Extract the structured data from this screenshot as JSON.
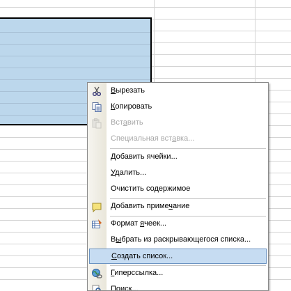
{
  "context_menu": {
    "items": [
      {
        "label_pre": "",
        "mnemonic": "В",
        "label_post": "ырезать",
        "icon": "scissors-icon",
        "enabled": true
      },
      {
        "label_pre": "",
        "mnemonic": "К",
        "label_post": "опировать",
        "icon": "copy-icon",
        "enabled": true
      },
      {
        "label_pre": "Вст",
        "mnemonic": "а",
        "label_post": "вить",
        "icon": "paste-icon",
        "enabled": false
      },
      {
        "label_pre": "Специальная вст",
        "mnemonic": "а",
        "label_post": "вка...",
        "icon": "",
        "enabled": false
      },
      {
        "label_pre": "",
        "mnemonic": "Д",
        "label_post": "обавить ячейки...",
        "icon": "",
        "enabled": true
      },
      {
        "label_pre": "",
        "mnemonic": "У",
        "label_post": "далить...",
        "icon": "",
        "enabled": true
      },
      {
        "label_pre": "Очистить со",
        "mnemonic": "д",
        "label_post": "ержимое",
        "icon": "",
        "enabled": true
      },
      {
        "label_pre": "Добавить приме",
        "mnemonic": "ч",
        "label_post": "ание",
        "icon": "comment-icon",
        "enabled": true
      },
      {
        "label_pre": "Формат ",
        "mnemonic": "я",
        "label_post": "чеек...",
        "icon": "format-cells-icon",
        "enabled": true
      },
      {
        "label_pre": "В",
        "mnemonic": "ы",
        "label_post": "брать из раскрывающегося списка...",
        "icon": "",
        "enabled": true
      },
      {
        "label_pre": "",
        "mnemonic": "С",
        "label_post": "оздать список...",
        "icon": "",
        "enabled": true,
        "highlighted": true
      },
      {
        "label_pre": "",
        "mnemonic": "Г",
        "label_post": "иперссылка...",
        "icon": "hyperlink-icon",
        "enabled": true
      },
      {
        "label_pre": "",
        "mnemonic": "П",
        "label_post": "оиск...",
        "icon": "search-icon",
        "enabled": true
      }
    ]
  }
}
